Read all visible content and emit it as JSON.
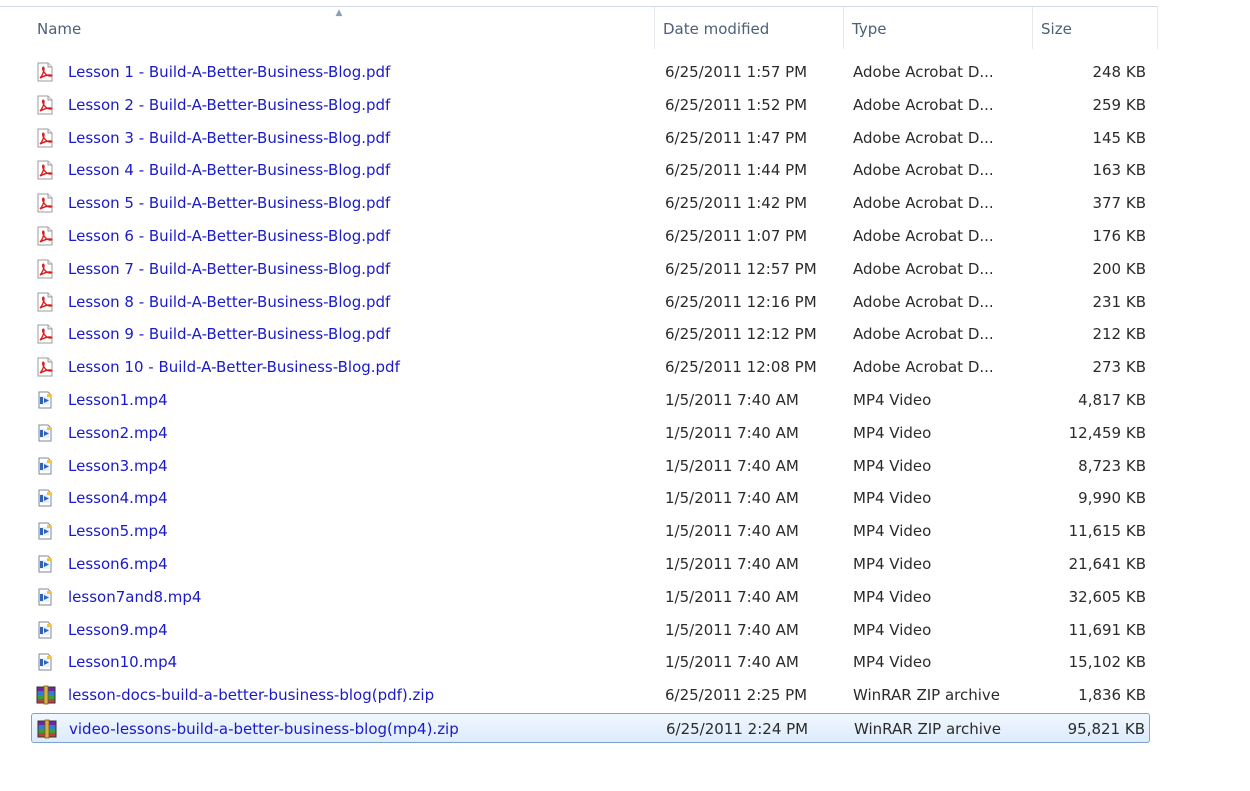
{
  "columns": {
    "name": "Name",
    "date_modified": "Date modified",
    "type": "Type",
    "size": "Size"
  },
  "sort": {
    "column": "name",
    "direction": "ascending"
  },
  "files": [
    {
      "name": "Lesson 1 - Build-A-Better-Business-Blog.pdf",
      "date": "6/25/2011 1:57 PM",
      "type": "Adobe Acrobat D...",
      "size": "248 KB",
      "icon": "pdf-icon",
      "selected": false
    },
    {
      "name": "Lesson 2 - Build-A-Better-Business-Blog.pdf",
      "date": "6/25/2011 1:52 PM",
      "type": "Adobe Acrobat D...",
      "size": "259 KB",
      "icon": "pdf-icon",
      "selected": false
    },
    {
      "name": "Lesson 3 - Build-A-Better-Business-Blog.pdf",
      "date": "6/25/2011 1:47 PM",
      "type": "Adobe Acrobat D...",
      "size": "145 KB",
      "icon": "pdf-icon",
      "selected": false
    },
    {
      "name": "Lesson 4 - Build-A-Better-Business-Blog.pdf",
      "date": "6/25/2011 1:44 PM",
      "type": "Adobe Acrobat D...",
      "size": "163 KB",
      "icon": "pdf-icon",
      "selected": false
    },
    {
      "name": "Lesson 5 - Build-A-Better-Business-Blog.pdf",
      "date": "6/25/2011 1:42 PM",
      "type": "Adobe Acrobat D...",
      "size": "377 KB",
      "icon": "pdf-icon",
      "selected": false
    },
    {
      "name": "Lesson 6 - Build-A-Better-Business-Blog.pdf",
      "date": "6/25/2011 1:07 PM",
      "type": "Adobe Acrobat D...",
      "size": "176 KB",
      "icon": "pdf-icon",
      "selected": false
    },
    {
      "name": "Lesson 7 - Build-A-Better-Business-Blog.pdf",
      "date": "6/25/2011 12:57 PM",
      "type": "Adobe Acrobat D...",
      "size": "200 KB",
      "icon": "pdf-icon",
      "selected": false
    },
    {
      "name": "Lesson 8 - Build-A-Better-Business-Blog.pdf",
      "date": "6/25/2011 12:16 PM",
      "type": "Adobe Acrobat D...",
      "size": "231 KB",
      "icon": "pdf-icon",
      "selected": false
    },
    {
      "name": "Lesson 9 - Build-A-Better-Business-Blog.pdf",
      "date": "6/25/2011 12:12 PM",
      "type": "Adobe Acrobat D...",
      "size": "212 KB",
      "icon": "pdf-icon",
      "selected": false
    },
    {
      "name": "Lesson 10 - Build-A-Better-Business-Blog.pdf",
      "date": "6/25/2011 12:08 PM",
      "type": "Adobe Acrobat D...",
      "size": "273 KB",
      "icon": "pdf-icon",
      "selected": false
    },
    {
      "name": "Lesson1.mp4",
      "date": "1/5/2011 7:40 AM",
      "type": "MP4 Video",
      "size": "4,817 KB",
      "icon": "video-file-icon",
      "selected": false
    },
    {
      "name": "Lesson2.mp4",
      "date": "1/5/2011 7:40 AM",
      "type": "MP4 Video",
      "size": "12,459 KB",
      "icon": "video-file-icon",
      "selected": false
    },
    {
      "name": "Lesson3.mp4",
      "date": "1/5/2011 7:40 AM",
      "type": "MP4 Video",
      "size": "8,723 KB",
      "icon": "video-file-icon",
      "selected": false
    },
    {
      "name": "Lesson4.mp4",
      "date": "1/5/2011 7:40 AM",
      "type": "MP4 Video",
      "size": "9,990 KB",
      "icon": "video-file-icon",
      "selected": false
    },
    {
      "name": "Lesson5.mp4",
      "date": "1/5/2011 7:40 AM",
      "type": "MP4 Video",
      "size": "11,615 KB",
      "icon": "video-file-icon",
      "selected": false
    },
    {
      "name": "Lesson6.mp4",
      "date": "1/5/2011 7:40 AM",
      "type": "MP4 Video",
      "size": "21,641 KB",
      "icon": "video-file-icon",
      "selected": false
    },
    {
      "name": "lesson7and8.mp4",
      "date": "1/5/2011 7:40 AM",
      "type": "MP4 Video",
      "size": "32,605 KB",
      "icon": "video-file-icon",
      "selected": false
    },
    {
      "name": "Lesson9.mp4",
      "date": "1/5/2011 7:40 AM",
      "type": "MP4 Video",
      "size": "11,691 KB",
      "icon": "video-file-icon",
      "selected": false
    },
    {
      "name": "Lesson10.mp4",
      "date": "1/5/2011 7:40 AM",
      "type": "MP4 Video",
      "size": "15,102 KB",
      "icon": "video-file-icon",
      "selected": false
    },
    {
      "name": "lesson-docs-build-a-better-business-blog(pdf).zip",
      "date": "6/25/2011 2:25 PM",
      "type": "WinRAR ZIP archive",
      "size": "1,836 KB",
      "icon": "winrar-archive-icon",
      "selected": false
    },
    {
      "name": "video-lessons-build-a-better-business-blog(mp4).zip",
      "date": "6/25/2011 2:24 PM",
      "type": "WinRAR ZIP archive",
      "size": "95,821 KB",
      "icon": "winrar-archive-icon",
      "selected": true
    }
  ]
}
